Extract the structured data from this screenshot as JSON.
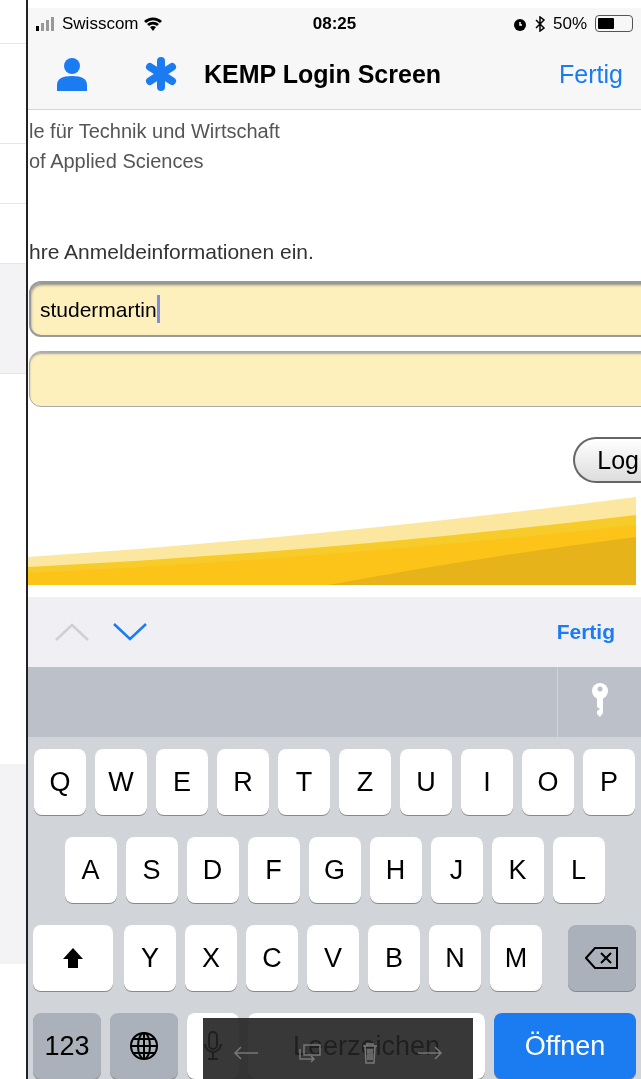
{
  "status_bar": {
    "carrier": "Swisscom",
    "time": "08:25",
    "battery": "50%"
  },
  "nav_bar": {
    "title": "KEMP Login Screen",
    "done": "Fertig"
  },
  "web_page": {
    "header_lines": [
      "le für Technik und Wirtschaft",
      "of Applied Sciences"
    ],
    "instruction": "hre Anmeldeinformationen ein.",
    "fields": [
      {
        "value": "studermartin",
        "focused": true
      },
      {
        "focused": false
      }
    ],
    "login_button": "Log"
  },
  "accessory_bar": {
    "previous_disabled": true,
    "next_disabled": false,
    "done": "Fertig"
  },
  "keyboard": {
    "rows": [
      [
        "Q",
        "W",
        "E",
        "R",
        "T",
        "Z",
        "U",
        "I",
        "O",
        "P"
      ],
      [
        "A",
        "S",
        "D",
        "F",
        "G",
        "H",
        "J",
        "K",
        "L"
      ],
      [
        "Y",
        "X",
        "C",
        "V",
        "B",
        "N",
        "M"
      ]
    ],
    "numbers_key": "123",
    "space": "Leerzeichen",
    "return": "Öffnen"
  }
}
